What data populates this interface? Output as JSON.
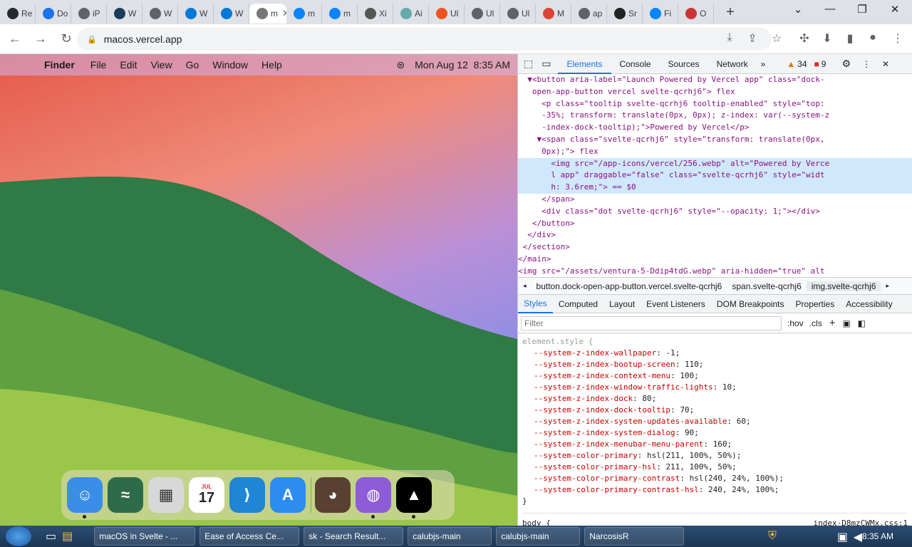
{
  "browser": {
    "tabs": [
      {
        "label": "Re",
        "icon": "github-icon"
      },
      {
        "label": "Do",
        "icon": "download-icon"
      },
      {
        "label": "iP",
        "icon": "globe-icon"
      },
      {
        "label": "W",
        "icon": "app-icon"
      },
      {
        "label": "W",
        "icon": "globe-icon"
      },
      {
        "label": "W",
        "icon": "windows-icon"
      },
      {
        "label": "W",
        "icon": "windows-icon"
      },
      {
        "label": "m",
        "icon": "macos-icon",
        "active": true
      },
      {
        "label": "m",
        "icon": "azure-icon"
      },
      {
        "label": "m",
        "icon": "azure-icon"
      },
      {
        "label": "Xi",
        "icon": "cat-icon"
      },
      {
        "label": "Ai",
        "icon": "sparkle-icon"
      },
      {
        "label": "Ul",
        "icon": "ubuntu-icon"
      },
      {
        "label": "Ul",
        "icon": "globe-icon"
      },
      {
        "label": "Ul",
        "icon": "globe-icon"
      },
      {
        "label": "M",
        "icon": "chrome-icon"
      },
      {
        "label": "ap",
        "icon": "globe-icon"
      },
      {
        "label": "Sr",
        "icon": "inkscape-icon"
      },
      {
        "label": "Fi",
        "icon": "azure-icon"
      },
      {
        "label": "O",
        "icon": "gradient-icon"
      }
    ],
    "new_tab": "+",
    "url": "macos.vercel.app"
  },
  "macos": {
    "app_name": "Finder",
    "menu": [
      "File",
      "Edit",
      "View",
      "Go",
      "Window",
      "Help"
    ],
    "datetime": "Mon Aug 12  8:35 AM",
    "calendar_month": "JUL",
    "calendar_day": "17",
    "dock": [
      {
        "name": "finder",
        "color": "#3b8ee8",
        "running": true
      },
      {
        "name": "wallpapers",
        "color": "#2e6b4a",
        "running": false
      },
      {
        "name": "calculator",
        "color": "#d8d8d8",
        "running": false
      },
      {
        "name": "calendar",
        "color": "#ffffff",
        "running": false
      },
      {
        "name": "vscode",
        "color": "#1f86d6",
        "running": false
      },
      {
        "name": "app-store",
        "color": "#2d8cf0",
        "running": false
      },
      {
        "name": "purrfect-remedy",
        "color": "#5a4030",
        "running": false
      },
      {
        "name": "github",
        "color": "#8e5cd6",
        "running": true
      },
      {
        "name": "vercel",
        "color": "#000000",
        "running": true
      }
    ]
  },
  "devtools": {
    "tabs": [
      "Elements",
      "Console",
      "Sources",
      "Network"
    ],
    "warnings": "34",
    "errors": "9",
    "dom_lines": [
      "  ▼<button aria-label=\"Launch Powered by Vercel app\" class=\"dock-",
      "   open-app-button vercel svelte-qcrhj6\"> flex",
      "     <p class=\"tooltip svelte-qcrhj6 tooltip-enabled\" style=\"top:",
      "     -35%; transform: translate(0px, 0px); z-index: var(--system-z",
      "     -index-dock-tooltip);\">Powered by Vercel</p>",
      "    ▼<span class=\"svelte-qcrhj6\" style=\"transform: translate(0px,",
      "     0px);\"> flex",
      "       <img src=\"/app-icons/vercel/256.webp\" alt=\"Powered by Verce",
      "       l app\" draggable=\"false\" class=\"svelte-qcrhj6\" style=\"widt",
      "       h: 3.6rem;\"> == $0",
      "     </span>",
      "     <div class=\"dot svelte-qcrhj6\" style=\"--opacity: 1;\"></div>",
      "   </button>",
      "  </div>",
      " </section>",
      "</main>",
      "<img src=\"/assets/ventura-5-Ddip4tdG.webp\" aria-hidden=\"true\" alt"
    ],
    "breadcrumbs": [
      "button.dock-open-app-button.vercel.svelte-qcrhj6",
      "span.svelte-qcrhj6",
      "img.svelte-qcrhj6"
    ],
    "subtabs": [
      "Styles",
      "Computed",
      "Layout",
      "Event Listeners",
      "DOM Breakpoints",
      "Properties",
      "Accessibility"
    ],
    "filter_placeholder": "Filter",
    "hov": ":hov",
    "cls": ".cls",
    "element_style": "element.style {",
    "styles": [
      {
        "p": "--system-z-index-wallpaper",
        "v": "-1;"
      },
      {
        "p": "--system-z-index-bootup-screen",
        "v": "110;"
      },
      {
        "p": "--system-z-index-context-menu",
        "v": "100;"
      },
      {
        "p": "--system-z-index-window-traffic-lights",
        "v": "10;"
      },
      {
        "p": "--system-z-index-dock",
        "v": "80;"
      },
      {
        "p": "--system-z-index-dock-tooltip",
        "v": "70;"
      },
      {
        "p": "--system-z-index-system-updates-available",
        "v": "60;"
      },
      {
        "p": "--system-z-index-system-dialog",
        "v": "90;"
      },
      {
        "p": "--system-z-index-menubar-menu-parent",
        "v": "160;"
      },
      {
        "p": "--system-color-primary",
        "v": "hsl(211, 100%, 50%);"
      },
      {
        "p": "--system-color-primary-hsl",
        "v": "211, 100%, 50%;"
      },
      {
        "p": "--system-color-primary-contrast",
        "v": "hsl(240, 24%, 100%);"
      },
      {
        "p": "--system-color-primary-contrast-hsl",
        "v": "240, 24%, 100%;"
      }
    ],
    "close_brace": "}",
    "body_rule": "body {",
    "body_source": "index-D8mzCWMx.css:1"
  },
  "taskbar": {
    "items": [
      "macOS in Svelte - ...",
      "Ease of Access Ce...",
      "sk - Search Result...",
      "calubjs-main",
      "calubjs-main",
      "NarcosisR"
    ],
    "time": "8:35 AM"
  }
}
